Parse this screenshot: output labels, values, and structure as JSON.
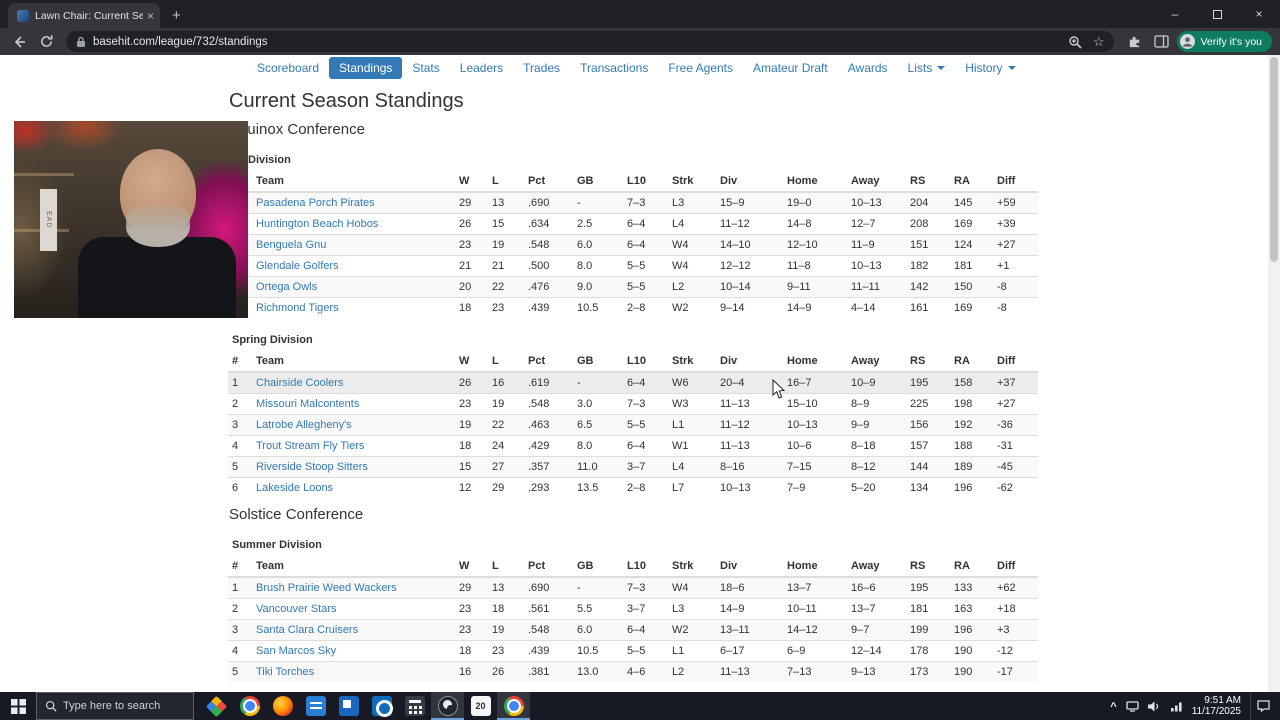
{
  "browser": {
    "tab_title": "Lawn Chair: Current Season Sta",
    "url": "basehit.com/league/732/standings",
    "verify_button": "Verify it's you"
  },
  "nav": {
    "items": [
      {
        "label": "Scoreboard",
        "active": false,
        "caret": false
      },
      {
        "label": "Standings",
        "active": true,
        "caret": false
      },
      {
        "label": "Stats",
        "active": false,
        "caret": false
      },
      {
        "label": "Leaders",
        "active": false,
        "caret": false
      },
      {
        "label": "Trades",
        "active": false,
        "caret": false
      },
      {
        "label": "Transactions",
        "active": false,
        "caret": false
      },
      {
        "label": "Free Agents",
        "active": false,
        "caret": false
      },
      {
        "label": "Amateur Draft",
        "active": false,
        "caret": false
      },
      {
        "label": "Awards",
        "active": false,
        "caret": false
      },
      {
        "label": "Lists",
        "active": false,
        "caret": true
      },
      {
        "label": "History",
        "active": false,
        "caret": true
      }
    ]
  },
  "page": {
    "title": "Current Season Standings",
    "table_headers": [
      "#",
      "Team",
      "W",
      "L",
      "Pct",
      "GB",
      "L10",
      "Strk",
      "Div",
      "Home",
      "Away",
      "RS",
      "RA",
      "Diff"
    ],
    "conferences": [
      {
        "name": "Equinox Conference",
        "divisions": [
          {
            "name": "Division",
            "occluded": true,
            "highlight_row": -1,
            "rows": [
              [
                "",
                "Pasadena Porch Pirates",
                "29",
                "13",
                ".690",
                "-",
                "7–3",
                "L3",
                "15–9",
                "19–0",
                "10–13",
                "204",
                "145",
                "+59"
              ],
              [
                "",
                "Huntington Beach Hobos",
                "26",
                "15",
                ".634",
                "2.5",
                "6–4",
                "L4",
                "11–12",
                "14–8",
                "12–7",
                "208",
                "169",
                "+39"
              ],
              [
                "",
                "Benguela Gnu",
                "23",
                "19",
                ".548",
                "6.0",
                "6–4",
                "W4",
                "14–10",
                "12–10",
                "11–9",
                "151",
                "124",
                "+27"
              ],
              [
                "",
                "Glendale Golfers",
                "21",
                "21",
                ".500",
                "8.0",
                "5–5",
                "W4",
                "12–12",
                "11–8",
                "10–13",
                "182",
                "181",
                "+1"
              ],
              [
                "",
                "Ortega Owls",
                "20",
                "22",
                ".476",
                "9.0",
                "5–5",
                "L2",
                "10–14",
                "9–11",
                "11–11",
                "142",
                "150",
                "-8"
              ],
              [
                "",
                "Richmond Tigers",
                "18",
                "23",
                ".439",
                "10.5",
                "2–8",
                "W2",
                "9–14",
                "14–9",
                "4–14",
                "161",
                "169",
                "-8"
              ]
            ]
          },
          {
            "name": "Spring Division",
            "occluded": false,
            "highlight_row": 0,
            "rows": [
              [
                "1",
                "Chairside Coolers",
                "26",
                "16",
                ".619",
                "-",
                "6–4",
                "W6",
                "20–4",
                "16–7",
                "10–9",
                "195",
                "158",
                "+37"
              ],
              [
                "2",
                "Missouri Malcontents",
                "23",
                "19",
                ".548",
                "3.0",
                "7–3",
                "W3",
                "11–13",
                "15–10",
                "8–9",
                "225",
                "198",
                "+27"
              ],
              [
                "3",
                "Latrobe Allegheny's",
                "19",
                "22",
                ".463",
                "6.5",
                "5–5",
                "L1",
                "11–12",
                "10–13",
                "9–9",
                "156",
                "192",
                "-36"
              ],
              [
                "4",
                "Trout Stream Fly Tiers",
                "18",
                "24",
                ".429",
                "8.0",
                "6–4",
                "W1",
                "11–13",
                "10–6",
                "8–18",
                "157",
                "188",
                "-31"
              ],
              [
                "5",
                "Riverside Stoop Sitters",
                "15",
                "27",
                ".357",
                "11.0",
                "3–7",
                "L4",
                "8–16",
                "7–15",
                "8–12",
                "144",
                "189",
                "-45"
              ],
              [
                "6",
                "Lakeside Loons",
                "12",
                "29",
                ".293",
                "13.5",
                "2–8",
                "L7",
                "10–13",
                "7–9",
                "5–20",
                "134",
                "196",
                "-62"
              ]
            ]
          }
        ]
      },
      {
        "name": "Solstice Conference",
        "divisions": [
          {
            "name": "Summer Division",
            "occluded": false,
            "highlight_row": -1,
            "rows": [
              [
                "1",
                "Brush Prairie Weed Wackers",
                "29",
                "13",
                ".690",
                "-",
                "7–3",
                "W4",
                "18–6",
                "13–7",
                "16–6",
                "195",
                "133",
                "+62"
              ],
              [
                "2",
                "Vancouver Stars",
                "23",
                "18",
                ".561",
                "5.5",
                "3–7",
                "L3",
                "14–9",
                "10–11",
                "13–7",
                "181",
                "163",
                "+18"
              ],
              [
                "3",
                "Santa Clara Cruisers",
                "23",
                "19",
                ".548",
                "6.0",
                "6–4",
                "W2",
                "13–11",
                "14–12",
                "9–7",
                "199",
                "196",
                "+3"
              ],
              [
                "4",
                "San Marcos Sky",
                "18",
                "23",
                ".439",
                "10.5",
                "5–5",
                "L1",
                "6–17",
                "6–9",
                "12–14",
                "178",
                "190",
                "-12"
              ],
              [
                "5",
                "Tiki Torches",
                "16",
                "26",
                ".381",
                "13.0",
                "4–6",
                "L2",
                "11–13",
                "7–13",
                "9–13",
                "173",
                "190",
                "-17"
              ]
            ]
          }
        ]
      }
    ]
  },
  "webcam": {
    "box_text": "EAD"
  },
  "taskbar": {
    "search_placeholder": "Type here to search",
    "calendar_label": "20",
    "clock_time": "9:51 AM",
    "clock_date": "11/17/2025"
  }
}
